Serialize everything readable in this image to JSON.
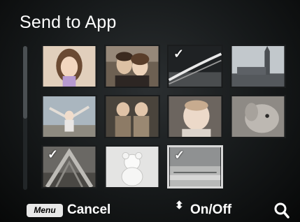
{
  "title": "Send to App",
  "thumbnails": [
    {
      "icon": "photo-girl-icon",
      "checked": false,
      "colors": [
        "#8f7a63",
        "#e9dacb"
      ]
    },
    {
      "icon": "photo-couple-icon",
      "checked": false,
      "colors": [
        "#5c5044",
        "#bfb1a2"
      ]
    },
    {
      "icon": "photo-road-icon",
      "checked": true,
      "colors": [
        "#2d3033",
        "#8d8f90"
      ]
    },
    {
      "icon": "photo-bigben-icon",
      "checked": false,
      "colors": [
        "#9da6ad",
        "#50545a"
      ]
    },
    {
      "icon": "photo-child-sky-icon",
      "checked": false,
      "colors": [
        "#8c9aa4",
        "#c9cdcf"
      ]
    },
    {
      "icon": "photo-twins-icon",
      "checked": false,
      "colors": [
        "#4e4840",
        "#a39a8f"
      ]
    },
    {
      "icon": "photo-baby-icon",
      "checked": false,
      "colors": [
        "#77706a",
        "#d1c8c0"
      ]
    },
    {
      "icon": "photo-dog-icon",
      "checked": false,
      "colors": [
        "#7d7a76",
        "#c6c2bd"
      ]
    },
    {
      "icon": "photo-arch-icon",
      "checked": true,
      "colors": [
        "#5c5a56",
        "#a5a4a0"
      ]
    },
    {
      "icon": "photo-teddy-icon",
      "checked": false,
      "colors": [
        "#c9c9c8",
        "#efefee"
      ]
    },
    {
      "icon": "photo-beach-icon",
      "checked": true,
      "colors": [
        "#55595a",
        "#b7b8b7"
      ]
    }
  ],
  "check_mark": "✓",
  "bottom_bar": {
    "menu_label": "Menu",
    "cancel_label": "Cancel",
    "updown_glyph": "⬍",
    "onoff_label": "On/Off",
    "search_icon": "search-icon"
  }
}
